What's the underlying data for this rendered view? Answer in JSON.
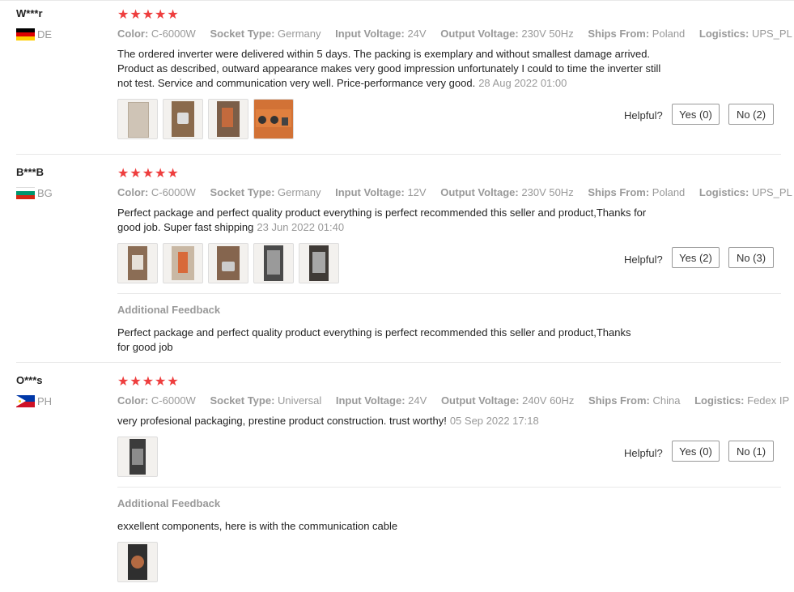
{
  "reviews": [
    {
      "user": "W***r",
      "country": "DE",
      "rating": "★★★★★",
      "attributes": [
        {
          "key": "Color:",
          "value": "C-6000W"
        },
        {
          "key": "Socket Type:",
          "value": "Germany"
        },
        {
          "key": "Input Voltage:",
          "value": "24V"
        },
        {
          "key": "Output Voltage:",
          "value": "230V 50Hz"
        },
        {
          "key": "Ships From:",
          "value": "Poland"
        },
        {
          "key": "Logistics:",
          "value": "UPS_PL"
        }
      ],
      "text_lines": [
        "The ordered inverter were delivered within 5 days. The packing is exemplary and without smallest damage arrived.",
        "Product as described, outward appearance makes very good impression unfortunately I could to time the inverter still",
        "not test. Service and communication very well. Price-performance very good."
      ],
      "date": "28 Aug 2022 01:00",
      "helpful_label": "Helpful?",
      "yes_label": "Yes (0)",
      "no_label": "No (2)"
    },
    {
      "user": "B***B",
      "country": "BG",
      "rating": "★★★★★",
      "attributes": [
        {
          "key": "Color:",
          "value": "C-6000W"
        },
        {
          "key": "Socket Type:",
          "value": "Germany"
        },
        {
          "key": "Input Voltage:",
          "value": "12V"
        },
        {
          "key": "Output Voltage:",
          "value": "230V 50Hz"
        },
        {
          "key": "Ships From:",
          "value": "Poland"
        },
        {
          "key": "Logistics:",
          "value": "UPS_PL"
        }
      ],
      "text_lines": [
        "Perfect package and perfect quality product everything is perfect recommended this seller and product,Thanks for",
        "good job. Super fast shipping"
      ],
      "date": "23 Jun 2022 01:40",
      "helpful_label": "Helpful?",
      "yes_label": "Yes (2)",
      "no_label": "No (3)",
      "additional_title": "Additional Feedback",
      "additional_lines": [
        "Perfect package and perfect quality product everything is perfect recommended this seller and product,Thanks",
        "for good job"
      ]
    },
    {
      "user": "O***s",
      "country": "PH",
      "rating": "★★★★★",
      "attributes": [
        {
          "key": "Color:",
          "value": "C-6000W"
        },
        {
          "key": "Socket Type:",
          "value": "Universal"
        },
        {
          "key": "Input Voltage:",
          "value": "24V"
        },
        {
          "key": "Output Voltage:",
          "value": "240V 60Hz"
        },
        {
          "key": "Ships From:",
          "value": "China"
        },
        {
          "key": "Logistics:",
          "value": "Fedex IP"
        }
      ],
      "text_lines": [
        "very profesional packaging, prestine product construction. trust worthy!"
      ],
      "date": "05 Sep 2022 17:18",
      "helpful_label": "Helpful?",
      "yes_label": "Yes (0)",
      "no_label": "No (1)",
      "additional_title": "Additional Feedback",
      "additional_lines": [
        "exxellent components, here is with the communication cable"
      ]
    }
  ],
  "icons": {
    "flag_de": "flag-germany-icon",
    "flag_bg": "flag-bulgaria-icon",
    "flag_ph": "flag-philippines-icon"
  },
  "colors": {
    "star": "#ee3e3e",
    "muted": "#999999",
    "divider": "#e8e8e8"
  }
}
